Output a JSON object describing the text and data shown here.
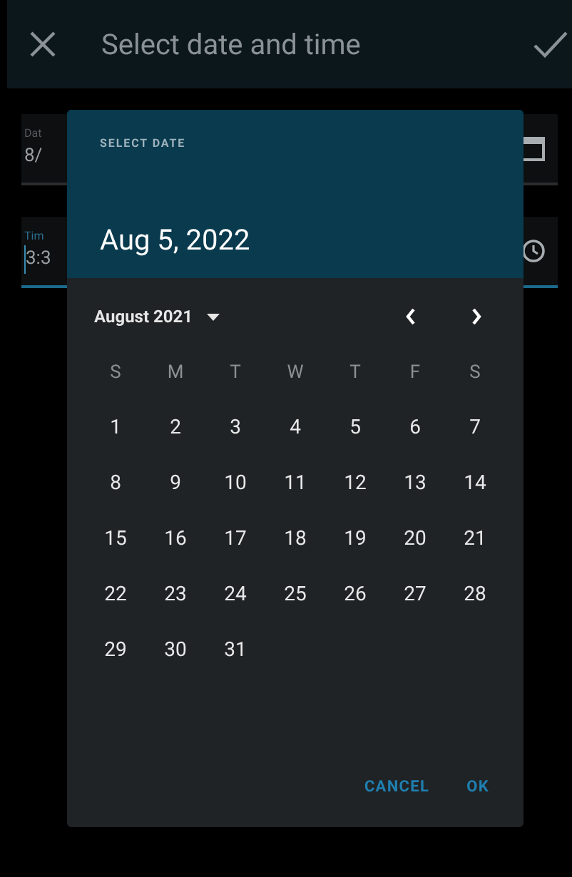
{
  "app_bar": {
    "title": "Select date and time"
  },
  "fields": [
    {
      "kind": "date",
      "label": "Dat",
      "value": "8/",
      "focused": false
    },
    {
      "kind": "time",
      "label": "Tim",
      "value": "3:3",
      "focused": true
    }
  ],
  "dialog": {
    "header_label": "SELECT DATE",
    "selected_date": "Aug 5, 2022",
    "month_label": "August 2021",
    "weekdays": [
      "S",
      "M",
      "T",
      "W",
      "T",
      "F",
      "S"
    ],
    "weeks": [
      [
        "1",
        "2",
        "3",
        "4",
        "5",
        "6",
        "7"
      ],
      [
        "8",
        "9",
        "10",
        "11",
        "12",
        "13",
        "14"
      ],
      [
        "15",
        "16",
        "17",
        "18",
        "19",
        "20",
        "21"
      ],
      [
        "22",
        "23",
        "24",
        "25",
        "26",
        "27",
        "28"
      ],
      [
        "29",
        "30",
        "31"
      ]
    ],
    "buttons": [
      "CANCEL",
      "OK"
    ]
  }
}
